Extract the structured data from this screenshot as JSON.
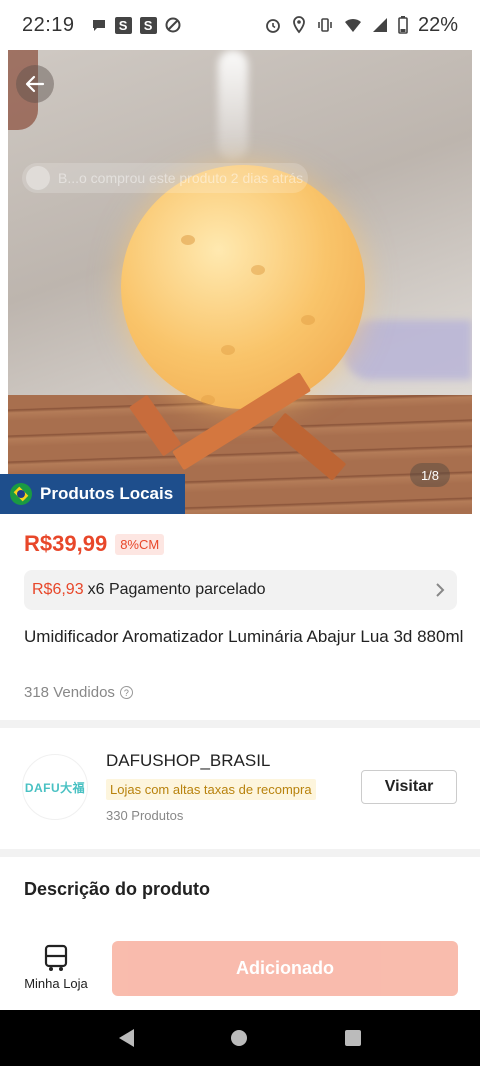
{
  "status_bar": {
    "time": "22:19",
    "battery": "22%",
    "left_icons": [
      "chat-bubble-icon",
      "s-app-icon",
      "s-app-icon",
      "no-entry-icon"
    ],
    "left_icon_letters": [
      "S",
      "S"
    ],
    "right_icons": [
      "alarm-icon",
      "location-icon",
      "vibrate-icon",
      "wifi-icon",
      "signal-icon",
      "battery-icon"
    ]
  },
  "hero": {
    "purchase_toast": "B...o comprou este produto 2 dias atrás",
    "image_counter": "1/8",
    "local_badge": "Produtos Locais"
  },
  "product": {
    "price": "R$39,99",
    "price_tag": "8%CM",
    "installment_amount": "R$6,93",
    "installment_text": "x6 Pagamento parcelado",
    "title": "Umidificador Aromatizador Luminária Abajur Lua 3d 880ml",
    "sold": "318 Vendidos"
  },
  "store": {
    "logo_text": "DAFU大福",
    "name": "DAFUSHOP_BRASIL",
    "tag": "Lojas com altas taxas de recompra",
    "products": "330 Produtos",
    "visit_label": "Visitar"
  },
  "description": {
    "title": "Descrição do produto"
  },
  "action_bar": {
    "my_store_label": "Minha Loja",
    "add_label": "Adicionado"
  },
  "colors": {
    "accent": "#e8472a",
    "local_badge": "#1e4e8c",
    "add_button": "#f9b8a9",
    "store_tag_text": "#b8820d"
  }
}
